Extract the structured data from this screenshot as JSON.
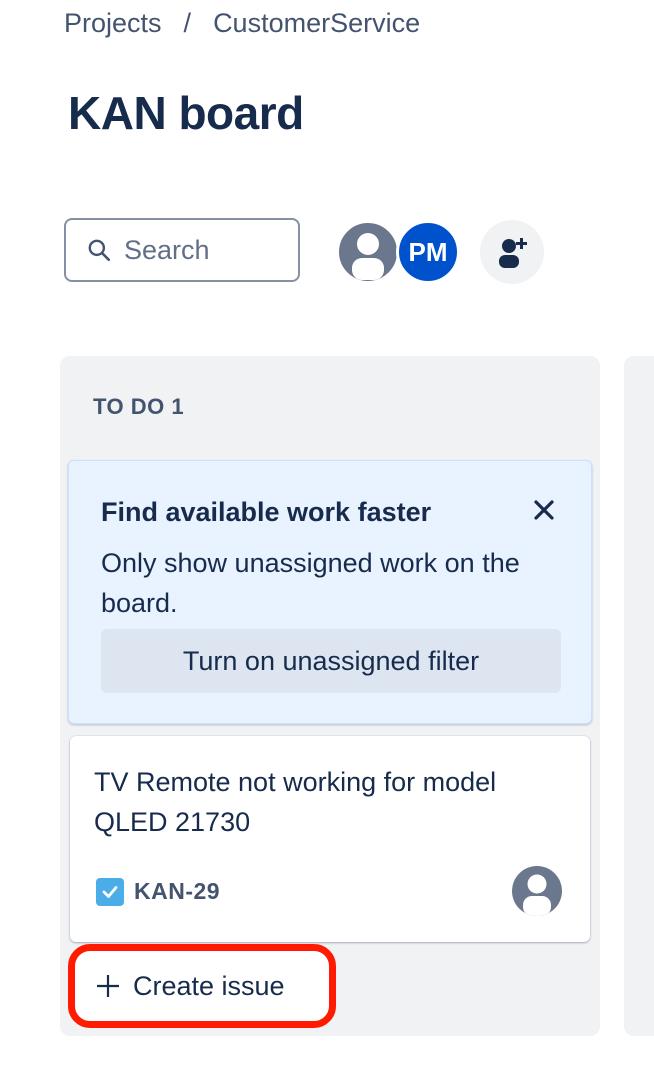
{
  "breadcrumb": {
    "items": [
      "Projects",
      "CustomerService"
    ],
    "separator": "/"
  },
  "page": {
    "title": "KAN board"
  },
  "toolbar": {
    "search_placeholder": "Search",
    "search_value": "",
    "avatars": [
      {
        "type": "default-user-icon",
        "color": "#6b778c"
      },
      {
        "initials": "PM",
        "color": "#0052cc"
      }
    ],
    "add_people_icon": "add-person-icon"
  },
  "columns": [
    {
      "header": "TO DO 1",
      "promo": {
        "title": "Find available work faster",
        "body": "Only show unassigned work on the board.",
        "button_label": "Turn on unassigned filter",
        "close_icon": "close-icon"
      },
      "cards": [
        {
          "title": "TV Remote not working for model QLED 21730",
          "key": "KAN-29",
          "type_icon": "task-checkbox-icon",
          "assignee_icon": "default-user-icon"
        }
      ],
      "create_label": "Create issue"
    }
  ],
  "colors": {
    "column_bg": "#f1f2f4",
    "promo_bg": "#e9f2ff",
    "highlight": "#ff1a00",
    "task_icon": "#4bade8"
  }
}
